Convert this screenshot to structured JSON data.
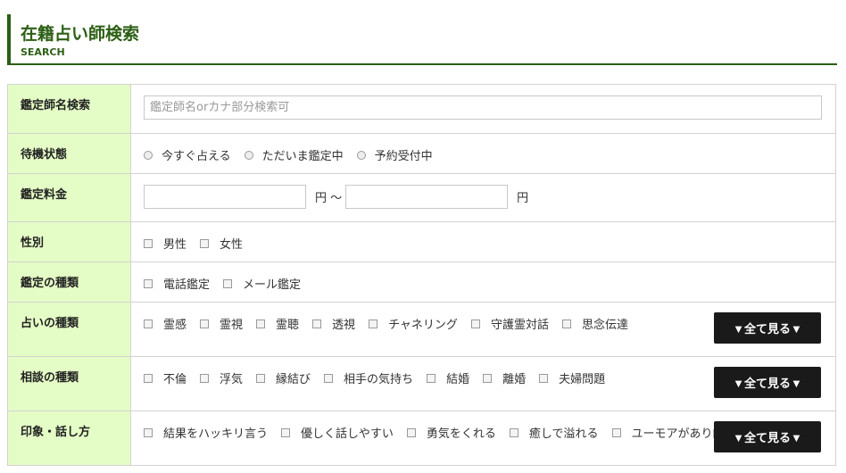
{
  "heading": {
    "title": "在籍占い師検索",
    "subtitle": "SEARCH"
  },
  "form": {
    "name": {
      "label": "鑑定師名検索",
      "placeholder": "鑑定師名orカナ部分検索可"
    },
    "status": {
      "label": "待機状態",
      "options": [
        "今すぐ占える",
        "ただいま鑑定中",
        "予約受付中"
      ]
    },
    "fee": {
      "label": "鑑定料金",
      "unit1": "円 ～",
      "unit2": "円"
    },
    "gender": {
      "label": "性別",
      "options": [
        "男性",
        "女性"
      ]
    },
    "method": {
      "label": "鑑定の種類",
      "options": [
        "電話鑑定",
        "メール鑑定"
      ]
    },
    "fortune": {
      "label": "占いの種類",
      "options": [
        "霊感",
        "霊視",
        "霊聴",
        "透視",
        "チャネリング",
        "守護霊対話",
        "思念伝達"
      ]
    },
    "consult": {
      "label": "相談の種類",
      "options": [
        "不倫",
        "浮気",
        "縁結び",
        "相手の気持ち",
        "結婚",
        "離婚",
        "夫婦問題"
      ]
    },
    "impression": {
      "label": "印象・話し方",
      "options": [
        "結果をハッキリ言う",
        "優しく話しやすい",
        "勇気をくれる",
        "癒しで溢れる",
        "ユーモアがあり的確"
      ]
    },
    "more_label": "▼全て見る▼"
  }
}
